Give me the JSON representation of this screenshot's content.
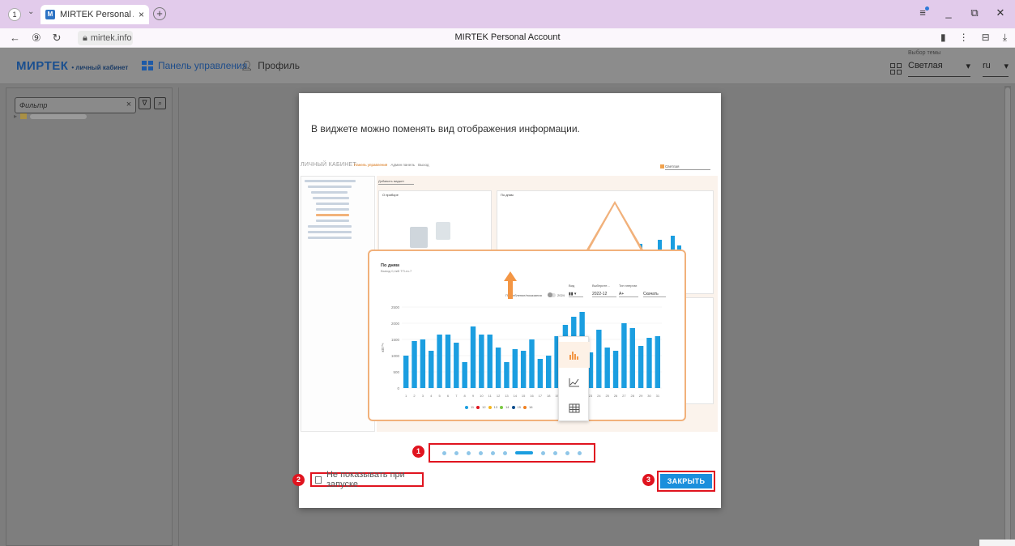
{
  "browser": {
    "tab_count": "1",
    "tab_title": "MIRTEK Personal Accou",
    "tab_favicon": "M",
    "url": "mirtek.info",
    "page_title": "MIRTEK Personal Account"
  },
  "header": {
    "logo": "МИРТЕК",
    "logo_sub": "• личный кабинет",
    "nav_dashboard": "Панель управления",
    "nav_profile": "Профиль",
    "theme_caption": "Выбор темы",
    "theme_value": "Светлая",
    "lang_value": "ru"
  },
  "sidebar": {
    "filter_placeholder": "Фильтр"
  },
  "dialog": {
    "text": "В виджете можно поменять вид отображения информации.",
    "pages_total": 11,
    "page_active": 7,
    "dont_show_label": "Не показывать при запуске",
    "close_label": "ЗАКРЫТЬ",
    "callouts": [
      "1",
      "2",
      "3"
    ]
  },
  "screenshot": {
    "logo": "ЛИЧНЫЙ КАБИНЕТ",
    "nav": [
      "Панель управления",
      "Админ панель",
      "Выход"
    ],
    "theme": "Светлая",
    "add_widget": "Добавить виджет",
    "card1_title": "О приборе",
    "card2_title": "По дням",
    "popup_title": "По дням",
    "popup_subtitle": "Вывод 0,4кВ ТП-ги-7",
    "ctl_consumption": "Потребление/показания",
    "ctl_year": "2024",
    "ctl_view_label": "Вид",
    "ctl_select_label": "Выберите...",
    "ctl_select_value": "2022-12",
    "ctl_energy_label": "Тип энергии",
    "ctl_energy_value": "A+",
    "ctl_download": "Скачать",
    "ylabel": "кВт*ч"
  },
  "chart_data": {
    "type": "bar",
    "categories": [
      "1",
      "2",
      "3",
      "4",
      "5",
      "6",
      "7",
      "8",
      "9",
      "10",
      "11",
      "12",
      "13",
      "14",
      "15",
      "16",
      "17",
      "18",
      "19",
      "20",
      "21",
      "22",
      "23",
      "24",
      "25",
      "26",
      "27",
      "28",
      "29",
      "30",
      "31"
    ],
    "values": [
      1000,
      1450,
      1500,
      1150,
      1650,
      1650,
      1400,
      800,
      1900,
      1650,
      1650,
      1250,
      800,
      1200,
      1150,
      1500,
      900,
      1000,
      1600,
      1950,
      2200,
      2350,
      1100,
      1800,
      1250,
      1150,
      2000,
      1850,
      1300,
      1550,
      1600
    ],
    "ylim": [
      0,
      2500
    ],
    "yticks": [
      "0",
      "500",
      "1000",
      "1500",
      "2000",
      "2500"
    ],
    "ylabel": "кВт*ч",
    "colors": {
      "bar": "#1b9ee0"
    }
  },
  "icons": {
    "bar_view": "bar-chart-icon",
    "line_view": "line-chart-icon",
    "table_view": "table-icon"
  }
}
